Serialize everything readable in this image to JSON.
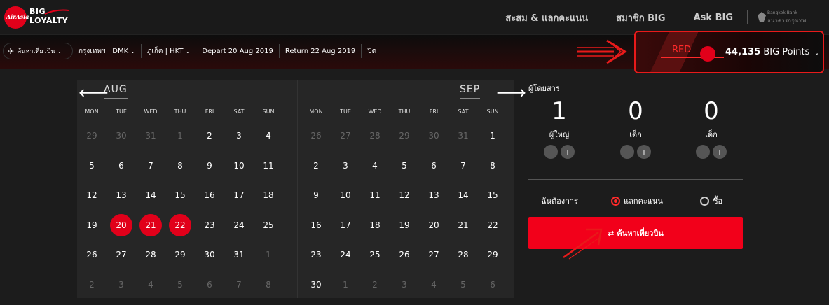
{
  "header": {
    "logo_script": "AirAsia",
    "logo_line1": "BIG",
    "logo_line2": "LOYALTY",
    "nav": [
      "สะสม & แลกคะแนน",
      "สมาชิก BIG",
      "Ask BIG"
    ],
    "partner_line1": "Bangkok Bank",
    "partner_line2": "ธนาคารกรุงเทพ"
  },
  "searchbar": {
    "trip_label": "ค้นหาเที่ยวบิน",
    "origin": "กรุงเทพฯ | DMK",
    "destination": "ภูเก็ต | HKT",
    "depart": "Depart 20 Aug 2019",
    "return": "Return 22 Aug 2019",
    "close": "ปิด"
  },
  "points": {
    "tier": "RED",
    "amount": "44,135",
    "unit": "BIG Points"
  },
  "calendar": {
    "weekdays": [
      "MON",
      "TUE",
      "WED",
      "THU",
      "FRI",
      "SAT",
      "SUN"
    ],
    "months": [
      {
        "name": "AUG",
        "days": [
          {
            "d": "29",
            "m": true
          },
          {
            "d": "30",
            "m": true
          },
          {
            "d": "31",
            "m": true
          },
          {
            "d": "1",
            "m": true
          },
          {
            "d": "2"
          },
          {
            "d": "3"
          },
          {
            "d": "4"
          },
          {
            "d": "5"
          },
          {
            "d": "6"
          },
          {
            "d": "7"
          },
          {
            "d": "8"
          },
          {
            "d": "9"
          },
          {
            "d": "10"
          },
          {
            "d": "11"
          },
          {
            "d": "12"
          },
          {
            "d": "13"
          },
          {
            "d": "14"
          },
          {
            "d": "15"
          },
          {
            "d": "16"
          },
          {
            "d": "17"
          },
          {
            "d": "18"
          },
          {
            "d": "19"
          },
          {
            "d": "20",
            "s": true
          },
          {
            "d": "21",
            "s": true
          },
          {
            "d": "22",
            "s": true
          },
          {
            "d": "23"
          },
          {
            "d": "24"
          },
          {
            "d": "25"
          },
          {
            "d": "26"
          },
          {
            "d": "27"
          },
          {
            "d": "28"
          },
          {
            "d": "29"
          },
          {
            "d": "30"
          },
          {
            "d": "31"
          },
          {
            "d": "1",
            "m": true
          },
          {
            "d": "2",
            "m": true
          },
          {
            "d": "3",
            "m": true
          },
          {
            "d": "4",
            "m": true
          },
          {
            "d": "5",
            "m": true
          },
          {
            "d": "6",
            "m": true
          },
          {
            "d": "7",
            "m": true
          },
          {
            "d": "8",
            "m": true
          }
        ]
      },
      {
        "name": "SEP",
        "days": [
          {
            "d": "26",
            "m": true
          },
          {
            "d": "27",
            "m": true
          },
          {
            "d": "28",
            "m": true
          },
          {
            "d": "29",
            "m": true
          },
          {
            "d": "30",
            "m": true
          },
          {
            "d": "31",
            "m": true
          },
          {
            "d": "1"
          },
          {
            "d": "2"
          },
          {
            "d": "3"
          },
          {
            "d": "4"
          },
          {
            "d": "5"
          },
          {
            "d": "6"
          },
          {
            "d": "7"
          },
          {
            "d": "8"
          },
          {
            "d": "9"
          },
          {
            "d": "10"
          },
          {
            "d": "11"
          },
          {
            "d": "12"
          },
          {
            "d": "13"
          },
          {
            "d": "14"
          },
          {
            "d": "15"
          },
          {
            "d": "16"
          },
          {
            "d": "17"
          },
          {
            "d": "18"
          },
          {
            "d": "19"
          },
          {
            "d": "20"
          },
          {
            "d": "21"
          },
          {
            "d": "22"
          },
          {
            "d": "23"
          },
          {
            "d": "24"
          },
          {
            "d": "25"
          },
          {
            "d": "26"
          },
          {
            "d": "27"
          },
          {
            "d": "28"
          },
          {
            "d": "29"
          },
          {
            "d": "30"
          },
          {
            "d": "1",
            "m": true
          },
          {
            "d": "2",
            "m": true
          },
          {
            "d": "3",
            "m": true
          },
          {
            "d": "4",
            "m": true
          },
          {
            "d": "5",
            "m": true
          },
          {
            "d": "6",
            "m": true
          }
        ]
      }
    ]
  },
  "passengers": {
    "title": "ผู้โดยสาร",
    "groups": [
      {
        "count": "1",
        "label": "ผู้ใหญ่"
      },
      {
        "count": "0",
        "label": "เด็ก"
      },
      {
        "count": "0",
        "label": "เด็ก"
      }
    ],
    "minus": "−",
    "plus": "+"
  },
  "options": {
    "want_label": "ฉันต้องการ",
    "redeem": "แลกคะแนน",
    "buy": "ซื้อ",
    "selected": "redeem"
  },
  "search_button": {
    "icon": "⇄",
    "label": "ค้นหาเที่ยวบิน"
  },
  "colors": {
    "accent": "#e1001a",
    "highlight": "#e81a1a"
  }
}
